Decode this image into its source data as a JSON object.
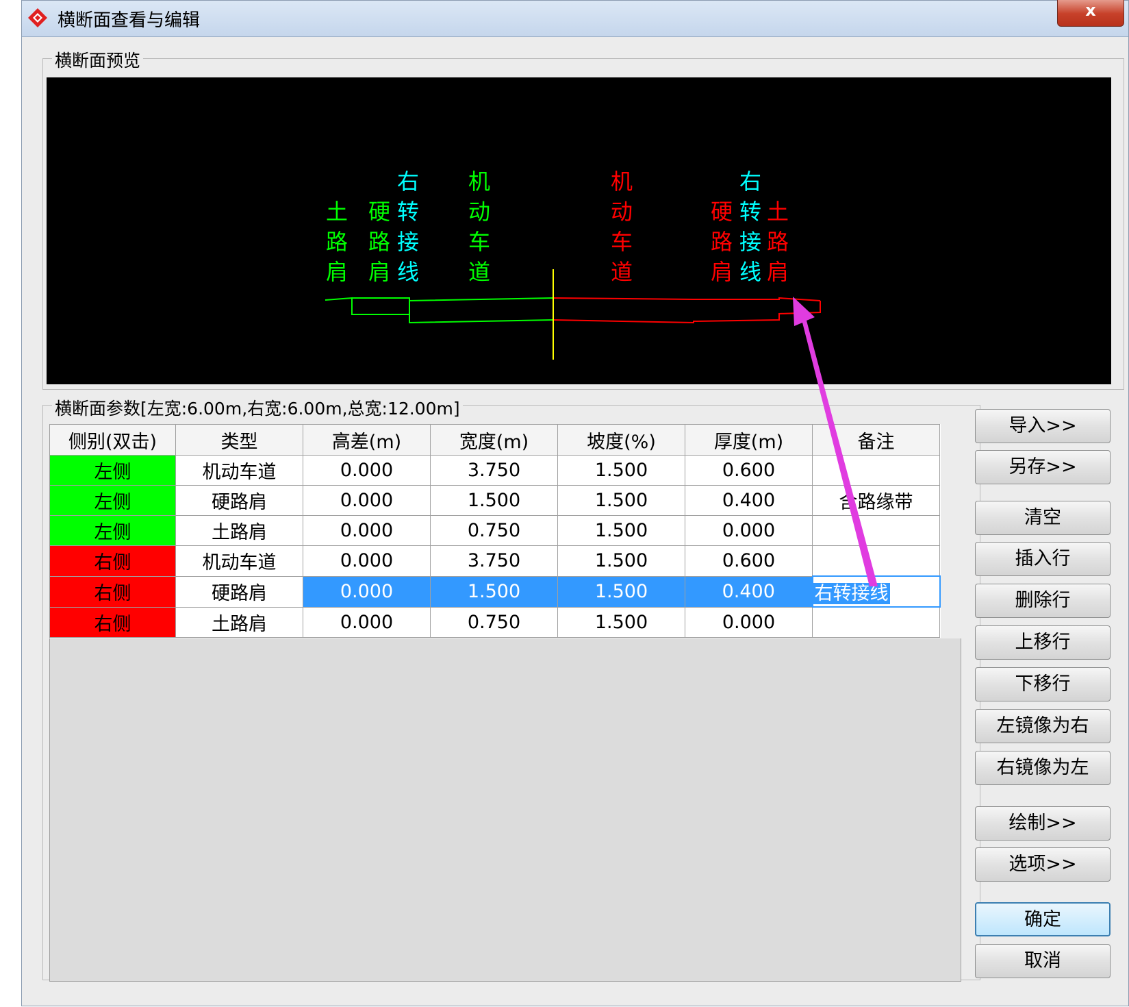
{
  "window": {
    "title": "横断面查看与编辑",
    "close_label": "x"
  },
  "preview": {
    "group_label": "横断面预览",
    "left_labels": [
      {
        "text": "土路肩",
        "color": "#00ff00"
      },
      {
        "text": "硬路肩",
        "color": "#00ff00"
      },
      {
        "text": "右转接线",
        "color": "#00ffff"
      },
      {
        "text": "机动车道",
        "color": "#00ff00"
      }
    ],
    "right_labels": [
      {
        "text": "机动车道",
        "color": "#ff0000"
      },
      {
        "text": "硬路肩",
        "color": "#ff0000"
      },
      {
        "text": "右转接线",
        "color": "#00ffff"
      },
      {
        "text": "土路肩",
        "color": "#ff0000"
      }
    ],
    "colors": {
      "left": "#00ff00",
      "right": "#ff0000",
      "center": "#ffff00",
      "annotation_arrow": "#e03ce0"
    }
  },
  "params": {
    "group_label": "横断面参数[左宽:6.00m,右宽:6.00m,总宽:12.00m]",
    "columns": [
      "侧别(双击)",
      "类型",
      "高差(m)",
      "宽度(m)",
      "坡度(%)",
      "厚度(m)",
      "备注"
    ],
    "rows": [
      {
        "side": "左侧",
        "type": "机动车道",
        "dh": "0.000",
        "width": "3.750",
        "slope": "1.500",
        "thick": "0.600",
        "note": ""
      },
      {
        "side": "左侧",
        "type": "硬路肩",
        "dh": "0.000",
        "width": "1.500",
        "slope": "1.500",
        "thick": "0.400",
        "note": "含路缘带"
      },
      {
        "side": "左侧",
        "type": "土路肩",
        "dh": "0.000",
        "width": "0.750",
        "slope": "1.500",
        "thick": "0.000",
        "note": ""
      },
      {
        "side": "右侧",
        "type": "机动车道",
        "dh": "0.000",
        "width": "3.750",
        "slope": "1.500",
        "thick": "0.600",
        "note": ""
      },
      {
        "side": "右侧",
        "type": "硬路肩",
        "dh": "0.000",
        "width": "1.500",
        "slope": "1.500",
        "thick": "0.400",
        "note": "右转接线"
      },
      {
        "side": "右侧",
        "type": "土路肩",
        "dh": "0.000",
        "width": "0.750",
        "slope": "1.500",
        "thick": "0.000",
        "note": ""
      }
    ],
    "selected_row": 4
  },
  "buttons": {
    "import": "导入>>",
    "save_as": "另存>>",
    "clear": "清空",
    "insert_row": "插入行",
    "delete_row": "删除行",
    "move_up": "上移行",
    "move_down": "下移行",
    "mirror_left_to_right": "左镜像为右",
    "mirror_right_to_left": "右镜像为左",
    "draw": "绘制>>",
    "options": "选项>>",
    "ok": "确定",
    "cancel": "取消"
  }
}
